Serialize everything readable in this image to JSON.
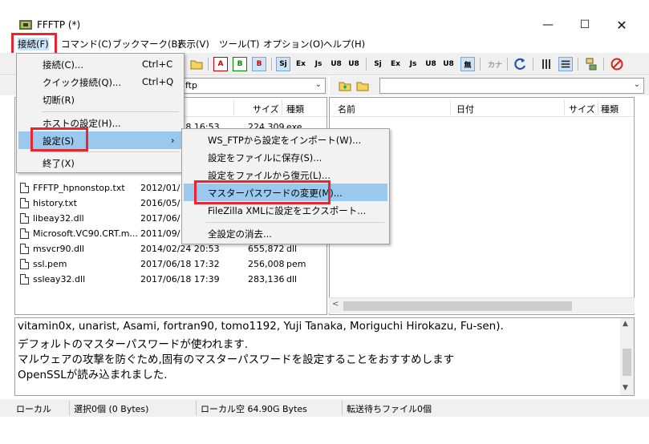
{
  "window": {
    "title": "FFFTP (*)",
    "min": "—",
    "max": "☐",
    "close": "✕"
  },
  "menubar": [
    {
      "label": "接続(F)"
    },
    {
      "label": "コマンド(C)"
    },
    {
      "label": "ブックマーク(B)"
    },
    {
      "label": "表示(V)"
    },
    {
      "label": "ツール(T)"
    },
    {
      "label": "オプション(O)"
    },
    {
      "label": "ヘルプ(H)"
    }
  ],
  "toolbar": {
    "buttons": [
      "A",
      "B",
      "B",
      "Sj",
      "Ex",
      "Js",
      "U8",
      "U8",
      "Sj",
      "Ex",
      "Js",
      "U8",
      "U8",
      "無",
      "カナ"
    ]
  },
  "local": {
    "path": "ftp",
    "columns": {
      "size": "サイズ",
      "type": "種類"
    },
    "rows": [
      {
        "name": "",
        "date": "2018/06/18 16:53",
        "size": "224,309",
        "type": "exe"
      },
      {
        "name": "FFFTP_hpnonstop.txt",
        "date": "2012/01/",
        "size": "",
        "type": ""
      },
      {
        "name": "history.txt",
        "date": "2016/05/",
        "size": "",
        "type": ""
      },
      {
        "name": "libeay32.dll",
        "date": "2017/06/",
        "size": "",
        "type": ""
      },
      {
        "name": "Microsoft.VC90.CRT.m...",
        "date": "2011/09/",
        "size": "",
        "type": ""
      },
      {
        "name": "msvcr90.dll",
        "date": "2014/02/24 20:53",
        "size": "655,872",
        "type": "dll"
      },
      {
        "name": "ssl.pem",
        "date": "2017/06/18 17:32",
        "size": "256,008",
        "type": "pem"
      },
      {
        "name": "ssleay32.dll",
        "date": "2017/06/18 17:39",
        "size": "283,136",
        "type": "dll"
      }
    ]
  },
  "remote": {
    "path": "",
    "columns": {
      "name": "名前",
      "date": "日付",
      "size": "サイズ",
      "type": "種類"
    }
  },
  "log": [
    "vitamin0x, unarist, Asami, fortran90, tomo1192, Yuji Tanaka, Moriguchi Hirokazu, Fu-sen).",
    "デフォルトのマスターパスワードが使われます.",
    "マルウェアの攻撃を防ぐため,固有のマスターパスワードを設定することをおすすめします",
    "OpenSSLが読み込まれました."
  ],
  "status": {
    "mode": "ローカル",
    "selected": "選択0個 (0 Bytes)",
    "free": "ローカル空 64.90G Bytes",
    "queue": "転送待ちファイル0個"
  },
  "connect_menu": {
    "items": [
      {
        "label": "接続(C)...",
        "shortcut": "Ctrl+C"
      },
      {
        "label": "クイック接続(Q)...",
        "shortcut": "Ctrl+Q"
      },
      {
        "label": "切断(R)",
        "shortcut": ""
      },
      {
        "label": "ホストの設定(H)...",
        "shortcut": ""
      },
      {
        "label": "設定(S)",
        "shortcut": ""
      },
      {
        "label": "終了(X)",
        "shortcut": ""
      }
    ],
    "submenu_arrow": "›"
  },
  "settings_menu": {
    "items": [
      {
        "label": "WS_FTPから設定をインポート(W)..."
      },
      {
        "label": "設定をファイルに保存(S)..."
      },
      {
        "label": "設定をファイルから復元(L)..."
      },
      {
        "label": "マスターパスワードの変更(M)..."
      },
      {
        "label": "FileZilla XMLに設定をエクスポート..."
      },
      {
        "label": "全設定の消去..."
      }
    ]
  },
  "highlight_color": "#e8262e"
}
